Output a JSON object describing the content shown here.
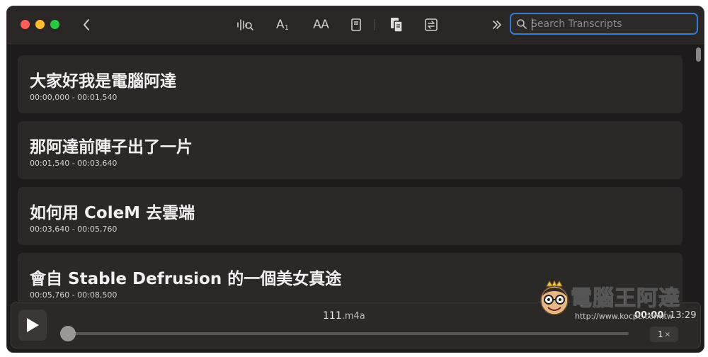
{
  "toolbar": {
    "back_icon": "chevron-left-icon",
    "font_small_label": "A",
    "font_small_sub": "1",
    "font_size_label": "AA",
    "overflow_icon": "chevron-double-right-icon"
  },
  "search": {
    "placeholder": "Search Transcripts",
    "value": ""
  },
  "transcripts": [
    {
      "text": "大家好我是電腦阿達",
      "time": "00:00,000 - 00:01,540"
    },
    {
      "text": "那阿達前陣子出了一片",
      "time": "00:01,540 - 00:03,640"
    },
    {
      "text": "如何用 ColeM 去雲端",
      "time": "00:03,640 - 00:05,760"
    },
    {
      "text": "會自 Stable Defrusion 的一個美女真途",
      "time": "00:05,760 - 00:08,500"
    }
  ],
  "player": {
    "file_name": "111",
    "file_ext": ".m4a",
    "current_time": "00:00",
    "separator": "/",
    "total_time": "13:29",
    "speed": "1",
    "speed_suffix": "×",
    "progress": 0
  },
  "partial_row_text": "…",
  "watermark": {
    "brand": "電腦王阿達",
    "url": "http://www.kocpc.com.tw"
  },
  "colors": {
    "accent": "#3c78c9",
    "window_bg": "#1d1b1b",
    "card_bg": "#2b2828"
  }
}
